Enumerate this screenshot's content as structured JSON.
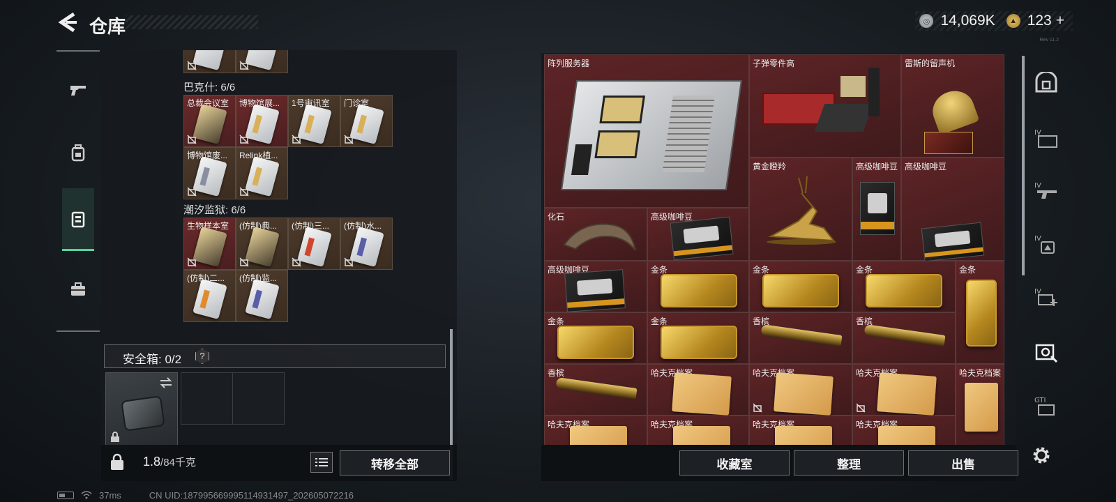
{
  "header": {
    "title": "仓库",
    "currency": {
      "coin_value": "14,069K",
      "gem_value": "123",
      "add_symbol": "+"
    },
    "version": "Rev 11.2"
  },
  "left_nav": [
    "gun-icon",
    "backpack-icon",
    "chest-rig-icon",
    "briefcase-icon"
  ],
  "left_panel": {
    "groups": [
      {
        "label": "巴克什: 6/6",
        "items": [
          "总裁会议室",
          "博物馆展...",
          "1号审讯室",
          "门诊室",
          "博物馆废...",
          "Relink植..."
        ]
      },
      {
        "label": "潮汐监狱: 6/6",
        "items": [
          "生物样本室",
          "(仿制)典...",
          "(仿制)三...",
          "(仿制)水...",
          "(仿制)二...",
          "(仿制)监..."
        ]
      }
    ],
    "safe_box": {
      "label": "安全箱: 0/2",
      "help": "?"
    },
    "weight": {
      "current": "1.8",
      "capacity": "/84千克"
    },
    "transfer_all": "转移全部"
  },
  "right_panel": {
    "items": [
      {
        "name": "阵列服务器",
        "type": "server"
      },
      {
        "name": "子弹零件高",
        "type": "parts"
      },
      {
        "name": "雷斯的留声机",
        "type": "gramophone"
      },
      {
        "name": "黄金瞪羚",
        "type": "gazelle"
      },
      {
        "name": "高级咖啡豆",
        "type": "coffee"
      },
      {
        "name": "化石",
        "type": "fossil"
      },
      {
        "name": "高级咖啡豆",
        "type": "coffee"
      },
      {
        "name": "高级咖啡豆",
        "type": "coffee"
      },
      {
        "name": "高级咖啡豆",
        "type": "coffee"
      },
      {
        "name": "金条",
        "type": "gold"
      },
      {
        "name": "金条",
        "type": "gold"
      },
      {
        "name": "金条",
        "type": "gold"
      },
      {
        "name": "金条",
        "type": "gold"
      },
      {
        "name": "金条",
        "type": "gold"
      },
      {
        "name": "金条",
        "type": "gold"
      },
      {
        "name": "香槟",
        "type": "bottle"
      },
      {
        "name": "香槟",
        "type": "bottle"
      },
      {
        "name": "香槟",
        "type": "bottle"
      },
      {
        "name": "哈夫克档案",
        "type": "folder"
      },
      {
        "name": "哈夫克档案",
        "type": "folder"
      },
      {
        "name": "哈夫克档案",
        "type": "folder"
      },
      {
        "name": "哈夫克档案",
        "type": "folder"
      },
      {
        "name": "哈夫克档案",
        "type": "folder"
      },
      {
        "name": "哈夫克档案",
        "type": "folder"
      },
      {
        "name": "哈夫克档案",
        "type": "folder"
      },
      {
        "name": "哈夫克档案",
        "type": "folder"
      }
    ],
    "buttons": {
      "collection": "收藏室",
      "organize": "整理",
      "sell": "出售"
    }
  },
  "right_tabs": [
    "vault-icon",
    "IV",
    "IV",
    "IV",
    "IV",
    "photo-icon",
    "GTI"
  ],
  "status": {
    "ping": "37ms",
    "uid": "CN UID:187995669995114931497_202605072216"
  },
  "colors": {
    "accent": "#4fd6a1",
    "item_red": "#5e2426",
    "item_brown": "#4d3b2c"
  }
}
